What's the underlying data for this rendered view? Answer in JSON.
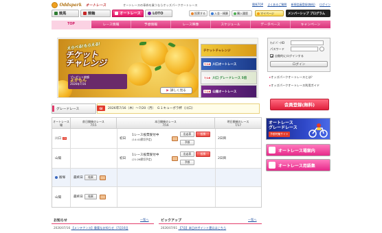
{
  "header": {
    "brand": "Oddspark",
    "brand_sub": "オートレース",
    "tagline": "オートレースの車券を買うならオッズパークオートレース",
    "top_links": [
      "競馬TOP",
      "よくあるご質問",
      "新規会員登録(無料)",
      "ログイン"
    ],
    "tabs": [
      {
        "label": "競馬",
        "icon": "horse-icon"
      },
      {
        "label": "競輪",
        "icon": "bicycle-icon"
      },
      {
        "label": "オートレース",
        "icon": "motorbike-icon"
      },
      {
        "label": "LOTO",
        "icon": "loto-icon"
      }
    ],
    "buttons": {
      "vote": "投票する",
      "deposit": "入金・精算",
      "purchase": "購入履歴",
      "mypage": "マイページ",
      "membership": "メンバーシップ プログラム"
    }
  },
  "nav": [
    "TOP",
    "レース情報",
    "予想情報",
    "レース映像",
    "スケジュール",
    "データベース",
    "キャンペーン"
  ],
  "banner": {
    "catch": "えらべる!もらえる!",
    "title_line1": "チケット",
    "title_line2": "チャレンジ",
    "sub_line1": "プレゼント総額",
    "sub_big": "よかもん",
    "sub_line2": "2026年7/16",
    "detail_button": "詳しく見る",
    "thumbs": [
      {
        "label": "チケットチャレンジ",
        "tag": "",
        "color": "#e8b828"
      },
      {
        "label": "川口オートレース",
        "tag": "7/16",
        "color": "#3a68c0"
      },
      {
        "label": "川口 グレードレース 5倍",
        "tag": "7/16",
        "color": "#28853a"
      },
      {
        "label": "山陽オートレース",
        "tag": "7/16",
        "color": "#7a2a8a"
      }
    ]
  },
  "grade": {
    "label": "グレードレース",
    "badge": "GI",
    "text": "2026年7/16（木）～7/20（月）　Ｇ１キューポラ杯（川口）"
  },
  "race_table": {
    "head_venue": "オートレース場",
    "head_prev": "前日開催のレース",
    "head_prev_date": "7/15",
    "head_today": "本日開催のレース",
    "head_today_date": "7/16",
    "head_next": "明日開催のレース",
    "head_next_date": "7/17",
    "rows": [
      {
        "venue": "川口",
        "badge": "GI",
        "day": "初日",
        "status": "1レース投票受付中",
        "deadline": "(14:41締切予定)",
        "next_day": "2日目"
      },
      {
        "venue": "山陽",
        "badge": "",
        "day": "初日",
        "status": "1レース投票受付中",
        "deadline": "(21:26締切予定)",
        "next_day": "2日目"
      },
      {
        "venue": "飯塚",
        "badge": "",
        "prev_day": "最終日",
        "result": "結果"
      },
      {
        "venue": "山陽",
        "badge": "",
        "prev_day": "最終日",
        "result": "結果"
      }
    ],
    "btn_entries": "出走表",
    "btn_vote": "投票",
    "btn_forecast": "予想"
  },
  "notice": {
    "title": "お知らせ",
    "more": "一覧へ",
    "date": "2026/07/16",
    "text": "【メンテナンス】重要なお知らせ（7月16日"
  },
  "pickup": {
    "title": "ピックアップ",
    "more": "一覧へ",
    "date": "2026/07/01",
    "text": "【7月】本日のポイント還元はこちら"
  },
  "login": {
    "id_label": "ｵｯｽﾞﾊﾟｰｸID",
    "pw_label": "パスワード",
    "auto_login": "自動的にログインする",
    "login_button": "ログイン",
    "links": [
      "オッズパークオートレースとは？",
      "オッズパークオートレース利用ガイド"
    ]
  },
  "register_button": "会員登録(無料)",
  "side": {
    "grade_title1": "オートレース",
    "grade_title2": "グレードレース",
    "grade_sub": "予想特集サイト",
    "venue_guide": "オートレース場案内",
    "glossary": "オートレース用語集"
  },
  "colors": {
    "accent_pink": "#e01666",
    "nav_pink": "#d8337a",
    "link_blue": "#1e4fa0",
    "gi_red": "#e23b2b"
  }
}
